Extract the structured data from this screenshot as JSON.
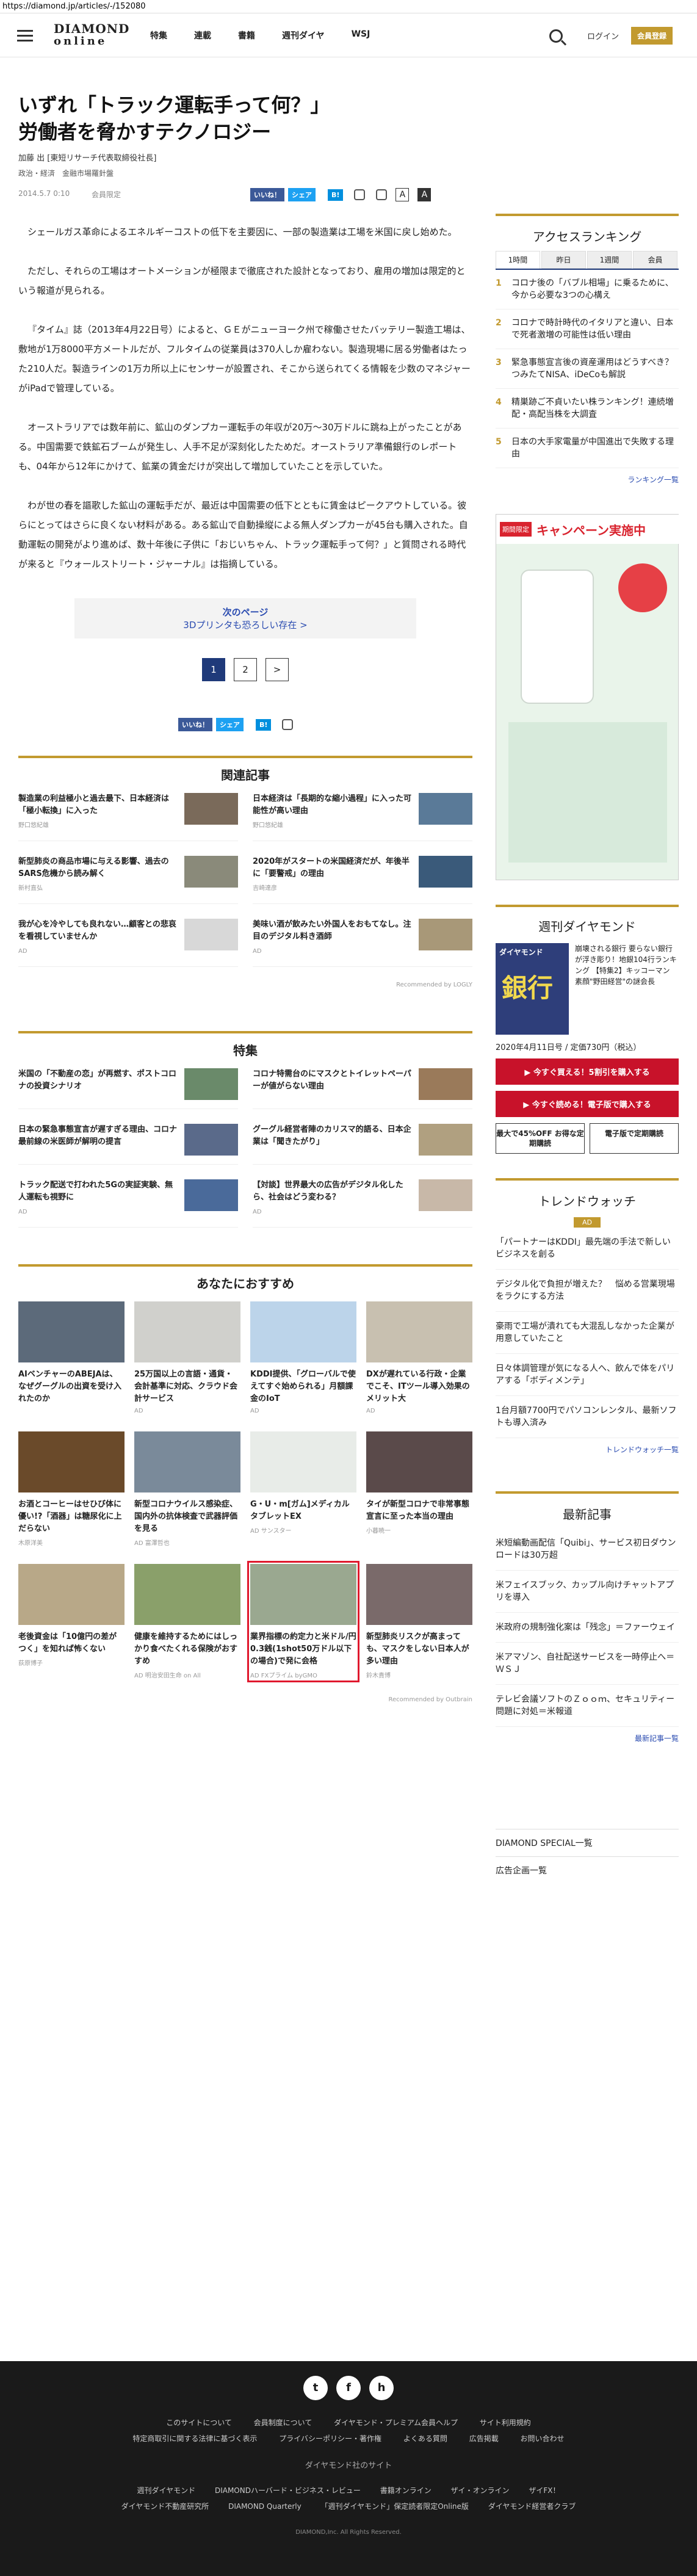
{
  "browser": {
    "url": "https://diamond.jp/articles/-/152080"
  },
  "header": {
    "logo_line1": "DIAMOND",
    "logo_line2": "online",
    "nav": [
      "特集",
      "連載",
      "書籍",
      "週刊ダイヤ",
      "WSJ"
    ],
    "login_label": "ログイン",
    "member_label": "会員登録"
  },
  "article": {
    "title_line1": "いずれ「トラック運転手って何？」",
    "title_line2": "労働者を脅かすテクノロジー",
    "byline": "加藤 出 [東短リサーチ代表取締役社長]",
    "tags": "政治・経済　金融市場羅針盤",
    "date": "2014.5.7 0:10",
    "ap_label": "会員限定",
    "share_fb": "いいね！",
    "share_tw": "シェア",
    "share_hb": "B!",
    "font_a": "A",
    "font_a2": "A",
    "paragraphs": [
      "シェールガス革命によるエネルギーコストの低下を主要因に、一部の製造業は工場を米国に戻し始めた。",
      "ただし、それらの工場はオートメーションが極限まで徹底された設計となっており、雇用の増加は限定的という報道が見られる。",
      "『タイム』誌（2013年4月22日号）によると、ＧＥがニューヨーク州で稼働させたバッテリー製造工場は、敷地が1万8000平方メートルだが、フルタイムの従業員は370人しか雇わない。製造現場に居る労働者はたった210人だ。製造ラインの1万カ所以上にセンサーが設置され、そこから送られてくる情報を少数のマネジャーがiPadで管理している。",
      "オーストラリアでは数年前に、鉱山のダンプカー運転手の年収が20万～30万ドルに跳ね上がったことがある。中国需要で鉄鉱石ブームが発生し、人手不足が深刻化したためだ。オーストラリア準備銀行のレポートも、04年から12年にかけて、鉱業の賃金だけが突出して増加していたことを示していた。",
      "わが世の春を謳歌した鉱山の運転手だが、最近は中国需要の低下とともに賃金はピークアウトしている。彼らにとってはさらに良くない材料がある。ある鉱山で自動操縦による無人ダンプカーが45台も購入された。自動運転の開発がより進めば、数十年後に子供に「おじいちゃん、トラック運転手って何？」と質問される時代が来ると『ウォールストリート・ジャーナル』は指摘している。"
    ],
    "next_label": "次のページ",
    "next_title": "3Dプリンタも恐ろしい存在 >",
    "pages": [
      "1",
      "2",
      ">"
    ]
  },
  "related": {
    "title": "関連記事",
    "items": [
      {
        "title": "製造業の利益極小と過去最下、日本経済は「極小転換」に入った",
        "src": "野口悠紀雄"
      },
      {
        "title": "日本経済は「長期的な縮小過程」に入った可能性が高い理由",
        "src": "野口悠紀雄"
      },
      {
        "title": "新型肺炎の商品市場に与える影響、過去のSARS危機から読み解く",
        "src": "新村直弘"
      },
      {
        "title": "2020年がスタートの米国経済だが、年後半に「要警戒」の理由",
        "src": "吉崎達彦"
      },
      {
        "title": "我が心を冷やしても良れない…顧客との悲哀を看視していませんか",
        "src": "AD"
      },
      {
        "title": "美味い酒が飲みたい外国人をおもてなし。注目のデジタル料き酒師",
        "src": "AD"
      }
    ],
    "recommended": "Recommended by LOGLY"
  },
  "feature": {
    "title": "特集",
    "items": [
      {
        "title": "米国の「不動産の恋」が再燃す、ポストコロナの投資シナリオ",
        "src": ""
      },
      {
        "title": "コロナ特需台のにマスクとトイレットペーパーが値がらない理由",
        "src": ""
      },
      {
        "title": "日本の緊急事態宣言が遅すぎる理由、コロナ最前線の米医師が解明の提言",
        "src": ""
      },
      {
        "title": "グーグル経営者陣のカリスマ的語る、日本企業は「聞きたがり」",
        "src": ""
      },
      {
        "title": "トラック配送で打われた5Gの実証実験、無人運転も視野に",
        "src": "AD"
      },
      {
        "title": "【対談】世界最大の広告がデジタル化したら、社会はどう変わる？",
        "src": "AD"
      }
    ]
  },
  "recommend": {
    "title": "あなたにおすすめ",
    "items": [
      {
        "title": "AIベンチャーのABEJAは、なぜグーグルの出資を受け入れたのか",
        "src": ""
      },
      {
        "title": "25万国以上の言語・通貨・会計基準に対応、クラウド会計サービス",
        "src": "AD"
      },
      {
        "title": "KDDI提供、「グローバルで使えてすぐ始められる」月額課金のIoT",
        "src": "AD"
      },
      {
        "title": "DXが遅れている行政・企業でこそ、ITツール導入効果のメリット大",
        "src": "AD"
      },
      {
        "title": "お酒とコーヒーはせひび体に優い!?「酒器」は糖尿化に上だらない",
        "src": "木原洋美"
      },
      {
        "title": "新型コロナウイルス感染症、国内外の抗体検査で武器評価を見る",
        "src": "AD 富澤哲也"
      },
      {
        "title": "G・U・m[ガム]メディカルタブレットEX",
        "src": "AD サンスター"
      },
      {
        "title": "タイが新型コロナで非常事態宣言に至った本当の理由",
        "src": "小暮暁一"
      },
      {
        "title": "老後資金は「10億円の差がつく」を知れば怖くない",
        "src": "荻原博子"
      },
      {
        "title": "健康を維持するためにはしっかり食べたくれる保険がおすすめ",
        "src": "AD 明治安田生命 on All"
      },
      {
        "title": "業界指標の約定力と米ドル/円0.3銭(1shot50万ドル以下の場合)で発に会格",
        "src": "AD FXプライム byGMO"
      },
      {
        "title": "新型肺炎リスクが高まっても、マスクをしない日本人が多い理由",
        "src": "鈴木貴博"
      }
    ],
    "recommended": "Recommended by Outbrain"
  },
  "sidebar": {
    "ranking_title": "アクセスランキング",
    "tabs": [
      "1時間",
      "昨日",
      "1週間",
      "会員"
    ],
    "ranking": [
      {
        "n": "1",
        "t": "コロナ後の「バブル相場」に乗るために、今から必要な3つの心構え"
      },
      {
        "n": "2",
        "t": "コロナで時計時代のイタリアと違い、日本で死者激増の可能性は低い理由"
      },
      {
        "n": "3",
        "t": "緊急事態宣言後の資産運用はどうすべき？つみたてNISA、iDeCoも解説"
      },
      {
        "n": "4",
        "t": "精巣跡ご不貞いたい株ランキング！連続増配・高配当株を大調査"
      },
      {
        "n": "5",
        "t": "日本の大手家電量が中国進出で失敗する理由"
      }
    ],
    "ranking_more": "ランキング一覧",
    "ad_badge": "期間限定",
    "ad_headline": "キャンペーン実施中",
    "weekly_title": "週刊ダイヤモンド",
    "weekly_cover_top": "ダイヤモンド",
    "weekly_cover_big": "銀行",
    "weekly_desc": "崩壊される銀行 要らない銀行が浮き彫り！地銀104行ランキング 【特集2】キッコーマン 素顔\"野田経営\"の謎会長",
    "weekly_date": "2020年4月11日号 / 定価730円（税込）",
    "btn_buy": "▶ 今すぐ買える！5割引を購入する",
    "btn_read": "▶ 今すぐ読める！電子版で購入する",
    "btn_subscribe": "最大で45%OFF お得な定期購読",
    "btn_digital": "電子版で定期購読",
    "trend_title": "トレンドウォッチ",
    "trend_ad": "AD",
    "trend": [
      "「パートナーはKDDI」最先端の手法で新しいビジネスを創る",
      "デジタル化で負担が増えた？　悩める営業現場をラクにする方法",
      "豪雨で工場が潰れても大混乱しなかった企業が用意していたこと",
      "日々体調管理が気になる人へ、飲んで体をパリアする「ボディメンテ」",
      "1台月額7700円でパソコンレンタル、最新ソフトも導入済み"
    ],
    "trend_more": "トレンドウォッチ一覧",
    "latest_title": "最新記事",
    "latest": [
      "米短編動画配信「Quibi」、サービス初日ダウンロードは30万超",
      "米フェイスブック、カップル向けチャットアプリを導入",
      "米政府の規制強化案は「残念」＝ファーウェイ",
      "米アマゾン、自社配送サービスを一時停止へ＝ＷＳＪ",
      "テレビ会議ソフトのＺｏｏｍ、セキュリティー問題に対処＝米報道"
    ],
    "latest_more": "最新記事一覧",
    "links": [
      "DIAMOND SPECIAL一覧",
      "広告企画一覧"
    ]
  },
  "footer": {
    "social": [
      "t",
      "f",
      "h"
    ],
    "links1": [
      "このサイトについて",
      "会員制度について",
      "ダイヤモンド・プレミアム会員ヘルプ",
      "サイト利用規約"
    ],
    "links2": [
      "特定商取引に関する法律に基づく表示",
      "プライバシーポリシー・著作権",
      "よくある質問",
      "広告掲載",
      "お問い合わせ"
    ],
    "group": "ダイヤモンド社のサイト",
    "links3": [
      "週刊ダイヤモンド",
      "DIAMONDハーバード・ビジネス・レビュー",
      "書籍オンライン",
      "ザイ・オンライン",
      "ザイFX！"
    ],
    "links4": [
      "ダイヤモンド不動産研究所",
      "DIAMOND Quarterly",
      "「週刊ダイヤモンド」保定読者限定Online版",
      "ダイヤモンド経営者クラブ"
    ],
    "copyright": "DIAMOND,Inc. All Rights Reserved."
  }
}
